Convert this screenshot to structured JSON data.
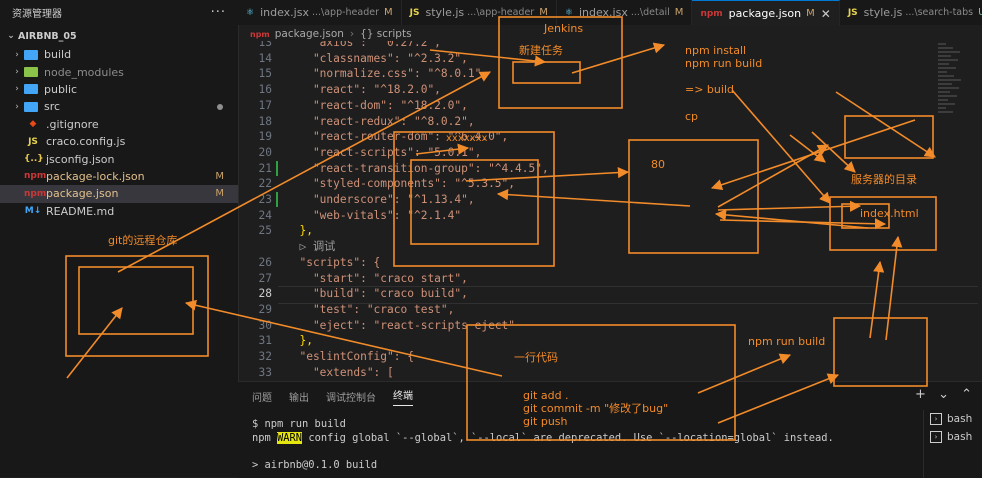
{
  "sidebar": {
    "title": "资源管理器",
    "more": "···",
    "section": "AIRBNB_05",
    "items": [
      {
        "label": "build",
        "kind": "folder",
        "color": "#42a5f5",
        "status": ""
      },
      {
        "label": "node_modules",
        "kind": "folder",
        "color": "#8bc34a",
        "status": ""
      },
      {
        "label": "public",
        "kind": "folder",
        "color": "#42a5f5",
        "status": ""
      },
      {
        "label": "src",
        "kind": "folder",
        "color": "#42a5f5",
        "status": "dot"
      },
      {
        "label": ".gitignore",
        "kind": "file",
        "icon": "◆",
        "iconColor": "#e64a19",
        "status": ""
      },
      {
        "label": "craco.config.js",
        "kind": "file",
        "icon": "JS",
        "iconColor": "#e8d44d",
        "status": ""
      },
      {
        "label": "jsconfig.json",
        "kind": "file",
        "icon": "{..}",
        "iconColor": "#e8c84d",
        "status": ""
      },
      {
        "label": "package-lock.json",
        "kind": "file",
        "icon": "npm",
        "iconColor": "#cb3837",
        "status": "M"
      },
      {
        "label": "package.json",
        "kind": "file",
        "icon": "npm",
        "iconColor": "#cb3837",
        "status": "M",
        "selected": true
      },
      {
        "label": "README.md",
        "kind": "file",
        "icon": "M↓",
        "iconColor": "#42a5f5",
        "status": ""
      }
    ]
  },
  "tabs": [
    {
      "icon": "⚛",
      "iconColor": "#61dafb",
      "label": "index.jsx",
      "path": "...\\app-header",
      "status": "M"
    },
    {
      "icon": "JS",
      "iconColor": "#e8d44d",
      "label": "style.js",
      "path": "...\\app-header",
      "status": "M"
    },
    {
      "icon": "⚛",
      "iconColor": "#61dafb",
      "label": "index.jsx",
      "path": "...\\detail",
      "status": "M"
    },
    {
      "icon": "npm",
      "iconColor": "#cb3837",
      "label": "package.json",
      "path": "",
      "status": "M",
      "active": true,
      "close": "✕"
    },
    {
      "icon": "JS",
      "iconColor": "#e8d44d",
      "label": "style.js",
      "path": "...\\search-tabs",
      "status": "U"
    }
  ],
  "breadcrumb": {
    "file": "package.json",
    "node": "{} scripts"
  },
  "editor": {
    "lines": [
      {
        "n": "13",
        "text": "    \"axios\": \"^0.27.2\","
      },
      {
        "n": "14",
        "text": "    \"classnames\": \"^2.3.2\","
      },
      {
        "n": "15",
        "text": "    \"normalize.css\": \"^8.0.1\","
      },
      {
        "n": "16",
        "text": "    \"react\": \"^18.2.0\","
      },
      {
        "n": "17",
        "text": "    \"react-dom\": \"^18.2.0\","
      },
      {
        "n": "18",
        "text": "    \"react-redux\": \"^8.0.2\","
      },
      {
        "n": "19",
        "text": "    \"react-router-dom\": \"^6.4.0\","
      },
      {
        "n": "20",
        "text": "    \"react-scripts\": \"5.0.1\","
      },
      {
        "n": "21",
        "text": "    \"react-transition-group\": \"^4.4.5\","
      },
      {
        "n": "22",
        "text": "    \"styled-components\": \"^5.3.5\","
      },
      {
        "n": "23",
        "text": "    \"underscore\": \"^1.13.4\","
      },
      {
        "n": "24",
        "text": "    \"web-vitals\": \"^2.1.4\""
      },
      {
        "n": "25",
        "text": "  },"
      },
      {
        "n": "",
        "text": "  ▷ 调试"
      },
      {
        "n": "26",
        "text": "  \"scripts\": {"
      },
      {
        "n": "27",
        "text": "    \"start\": \"craco start\","
      },
      {
        "n": "28",
        "text": "    \"build\": \"craco build\","
      },
      {
        "n": "29",
        "text": "    \"test\": \"craco test\","
      },
      {
        "n": "30",
        "text": "    \"eject\": \"react-scripts eject\""
      },
      {
        "n": "31",
        "text": "  },"
      },
      {
        "n": "32",
        "text": "  \"eslintConfig\": {"
      },
      {
        "n": "33",
        "text": "    \"extends\": ["
      }
    ]
  },
  "panel": {
    "tabs": [
      "问题",
      "输出",
      "调试控制台",
      "终端"
    ],
    "active_tab": "终端",
    "actions": "+ ⌄ ⌃",
    "terminal": {
      "line1": "$ npm run build",
      "line2_prefix": "npm ",
      "line2_warn": "WARN",
      "line2_rest": " config global `--global`, `--local` are deprecated. Use `--location=global` instead.",
      "line3": "> airbnb@0.1.0 build"
    },
    "shells": [
      "bash",
      "bash"
    ]
  },
  "annotations": {
    "color": "#f28b2a",
    "jenkins": "Jenkins",
    "new_task": "新建任务",
    "npm_install": "npm install\nnpm run build",
    "to_build": "=> build",
    "cp": "cp",
    "port": "80",
    "server_dir": "服务器的目录",
    "index_html": "index.html",
    "git_repo": "git的远程仓库",
    "one_line": "一行代码",
    "git_cmds": "git add .\ngit commit -m \"修改了bug\"\ngit push",
    "npm_run_build": "npm run build",
    "scribble": "xxxxxxx"
  }
}
